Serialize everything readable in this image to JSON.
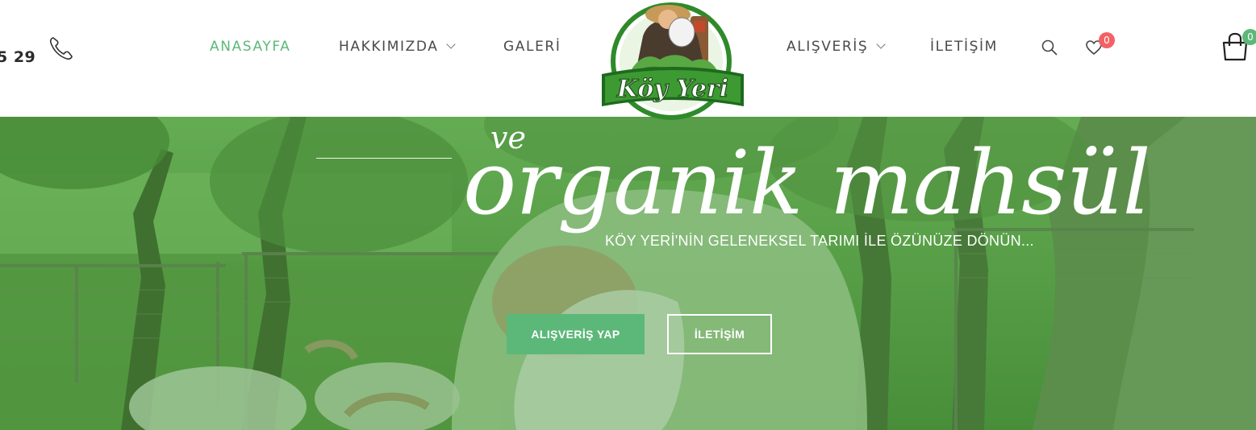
{
  "header": {
    "phone_number": "5 29",
    "nav_left": [
      {
        "label": "ANASAYFA"
      },
      {
        "label": "HAKKIMIZDA"
      },
      {
        "label": "GALERİ"
      }
    ],
    "nav_right": [
      {
        "label": "ALIŞVERİŞ"
      },
      {
        "label": "İLETİŞİM"
      }
    ],
    "wishlist_count": "0",
    "cart_count": "0",
    "logo_text": "Köy Yeri"
  },
  "hero": {
    "script_small": "ve",
    "script_large": "organik mahsül",
    "tagline": "KÖY YERİ'NİN GELENEKSEL TARIMI İLE ÖZÜNÜZE DÖNÜN...",
    "buttons": {
      "shop_label": "ALIŞVERİŞ YAP",
      "contact_label": "İLETİŞİM"
    }
  },
  "colors": {
    "accent": "#5cb878",
    "wishlist_badge": "#f06266",
    "cart_badge": "#5cb878",
    "overlay": "#3f8f3a"
  },
  "icons": [
    "phone-icon",
    "chevron-down-icon",
    "search-icon",
    "heart-icon",
    "shopping-bag-icon"
  ]
}
